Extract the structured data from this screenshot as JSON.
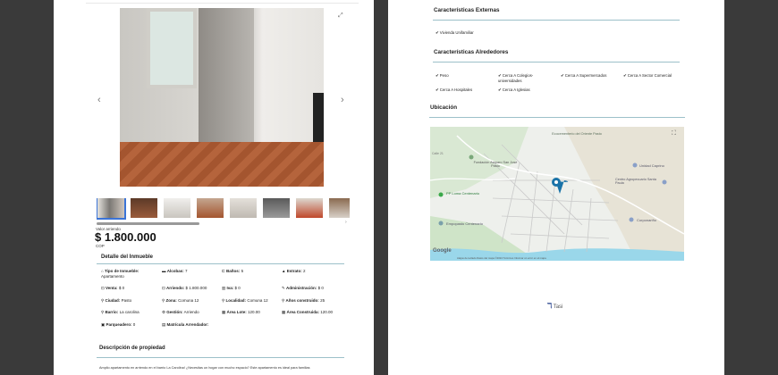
{
  "left_page": {
    "price_label": "Valor arriendo",
    "price": "$ 1.800.000",
    "currency": "COP",
    "detail_title": "Detalle del Inmueble",
    "details": [
      {
        "label": "Tipo de Inmueble:",
        "value": "Apartamento"
      },
      {
        "label": "Alcobas:",
        "value": "7"
      },
      {
        "label": "Baños:",
        "value": "5"
      },
      {
        "label": "Estrato:",
        "value": "2"
      },
      {
        "label": "Venta:",
        "value": "$ 0"
      },
      {
        "label": "Arriendo:",
        "value": "$ 1.800.000"
      },
      {
        "label": "Iva:",
        "value": "$ 0"
      },
      {
        "label": "Administración:",
        "value": "$ 0"
      },
      {
        "label": "Ciudad:",
        "value": "Pasto"
      },
      {
        "label": "Zona:",
        "value": "Comuna 12"
      },
      {
        "label": "Localidad:",
        "value": "Comuna 12"
      },
      {
        "label": "Años construido:",
        "value": "25"
      },
      {
        "label": "Barrio:",
        "value": "La carolina"
      },
      {
        "label": "Gestión:",
        "value": "Arriendo"
      },
      {
        "label": "Área Lote:",
        "value": "120.00"
      },
      {
        "label": "Área Construida:",
        "value": "120.00"
      },
      {
        "label": "Parqueadero:",
        "value": "0"
      },
      {
        "label": "Matrícula Arrendador:",
        "value": ""
      }
    ],
    "description_title": "Descripción de propiedad",
    "description_text": "Amplio apartamento en arriendo en el barrio La Carolina! ¿Necesitas un hogar con mucho espacio? Este apartamento es ideal para familias"
  },
  "right_page": {
    "external_title": "Características Externas",
    "external_items": [
      "Vivienda Unifamiliar"
    ],
    "surroundings_title": "Características Alrededores",
    "surroundings_items": [
      "Peso",
      "Cerca A Colegios-universidades",
      "Cerca A Supermercados",
      "Cerca A Sector Comercial",
      "Cerca A Hospitales",
      "Cerca A Iglesias"
    ],
    "location_title": "Ubicación",
    "map_labels": [
      "Ecocementerio del Oriente Pasto",
      "Fundación Amparo San José Pasto",
      "PP Loma Centenario",
      "Empopasto Centenario",
      "Unidad Caprino",
      "Centro Agropecuario Santa Paula",
      "Corponariño",
      "Calle 21",
      "Google"
    ],
    "map_footer": "Atajos de teclado  Datos del mapa ©2024  Términos  Informar un error en el mapa",
    "footer_brand": "Tasi"
  },
  "colors": {
    "rule": "#9cc0c9",
    "accent_thumb": "#3b73d6",
    "map_water": "#9ad7ea",
    "map_pin": "#1a73a8"
  }
}
